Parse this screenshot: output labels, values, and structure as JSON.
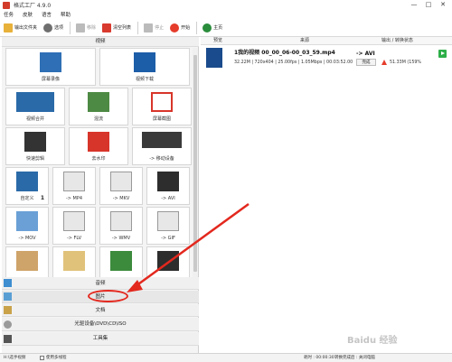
{
  "window": {
    "title": "格式工厂 4.9.0",
    "controls": [
      "—",
      "□",
      "✕"
    ]
  },
  "menubar": {
    "items": [
      "任务",
      "皮肤",
      "语言",
      "帮助"
    ]
  },
  "toolbar": {
    "buttons": [
      {
        "label": "输出文件夹",
        "icon": "folder-icon",
        "color": "#e8b13a",
        "enabled": true
      },
      {
        "label": "选项",
        "icon": "gear-icon",
        "color": "#6f6f6f",
        "enabled": true
      },
      {
        "label": "移除",
        "icon": "remove-icon",
        "color": "#bbbbbb",
        "enabled": false
      },
      {
        "label": "清空列表",
        "icon": "clear-list-icon",
        "color": "#d83a2e",
        "enabled": true
      },
      {
        "label": "停止",
        "icon": "stop-icon",
        "color": "#bbbbbb",
        "enabled": false
      },
      {
        "label": "开始",
        "icon": "start-icon",
        "color": "#e53c2b",
        "enabled": true
      },
      {
        "label": "主页",
        "icon": "home-icon",
        "color": "#2a8d3c",
        "enabled": true
      }
    ]
  },
  "left": {
    "video_header": "视频",
    "tiles": [
      [
        "屏幕录像",
        "视频下载"
      ],
      [
        "视频合并",
        "混流",
        "屏幕截图"
      ],
      [
        "快速剪辑",
        "去水印",
        "-> 移动设备"
      ],
      [
        "自定义",
        "-> MP4",
        "-> MKV",
        "-> AVI"
      ],
      [
        "-> MOV",
        "-> FLV",
        "-> WMV",
        "-> GIF"
      ],
      [
        "",
        "",
        "",
        ""
      ]
    ],
    "badge": "1",
    "sections": [
      "音频",
      "图片",
      "文档",
      "光驱设备\\DVD\\CD\\ISO",
      "工具集"
    ]
  },
  "right": {
    "columns": [
      "预览",
      "来源",
      "输出 / 转换状态"
    ],
    "file": {
      "name": "1我的视频 00_00_06-00_03_59.mp4",
      "info": "32.22M | 720x404 | 25.00fps | 1.05Mbps | 00:03:52.00",
      "target": "-> AVI",
      "status": "完成",
      "out_size": "51.33M (159%"
    }
  },
  "statusbar": {
    "path": "H:\\选手视频",
    "multithread": "使用多线程",
    "time": "耗时 : 00:00:30",
    "done_label": "转换完成后 : 关闭电脑"
  },
  "watermark": "Baidu 经验"
}
